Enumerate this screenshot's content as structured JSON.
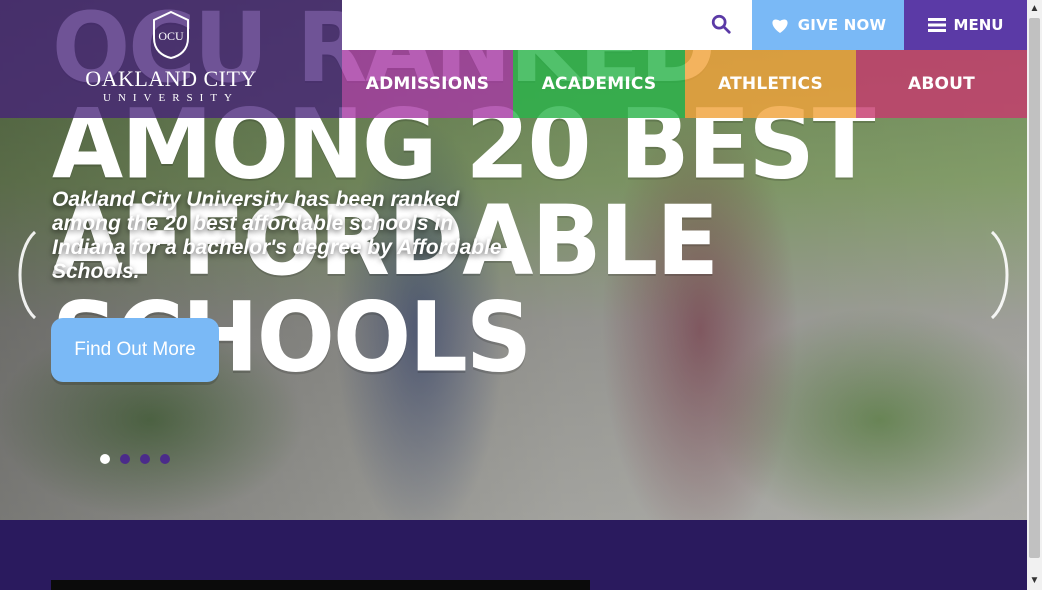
{
  "site": {
    "logo_name": "OAKLAND CITY",
    "logo_sub": "UNIVERSITY",
    "logo_mark": "OCU"
  },
  "top_bar": {
    "search_icon": "search-icon",
    "give_label": "GIVE NOW",
    "give_icon": "heart-icon",
    "menu_label": "MENU",
    "menu_icon": "hamburger-icon"
  },
  "nav": {
    "items": [
      {
        "label": "ADMISSIONS",
        "color": "#a63aa3"
      },
      {
        "label": "ACADEMICS",
        "color": "#2bb34a"
      },
      {
        "label": "ATHLETICS",
        "color": "#f0a23a"
      },
      {
        "label": "ABOUT",
        "color": "#c63b6e"
      }
    ]
  },
  "hero": {
    "headline": "OCU RANKED AMONG 20 BEST AFFORDABLE SCHOOLS",
    "subtext": "Oakland City University has been ranked among the 20 best affordable schools in Indiana for a bachelor's degree by Affordable Schools.",
    "cta_label": "Find Out More",
    "slides_count": 4,
    "active_slide": 1
  },
  "colors": {
    "brand_purple": "#5b3aa6",
    "header_overlay": "#46237a",
    "cta_blue": "#7ab9f6",
    "page_bg": "#2a1a5e"
  },
  "scrollbar": {
    "up_glyph": "▲",
    "down_glyph": "▼"
  }
}
